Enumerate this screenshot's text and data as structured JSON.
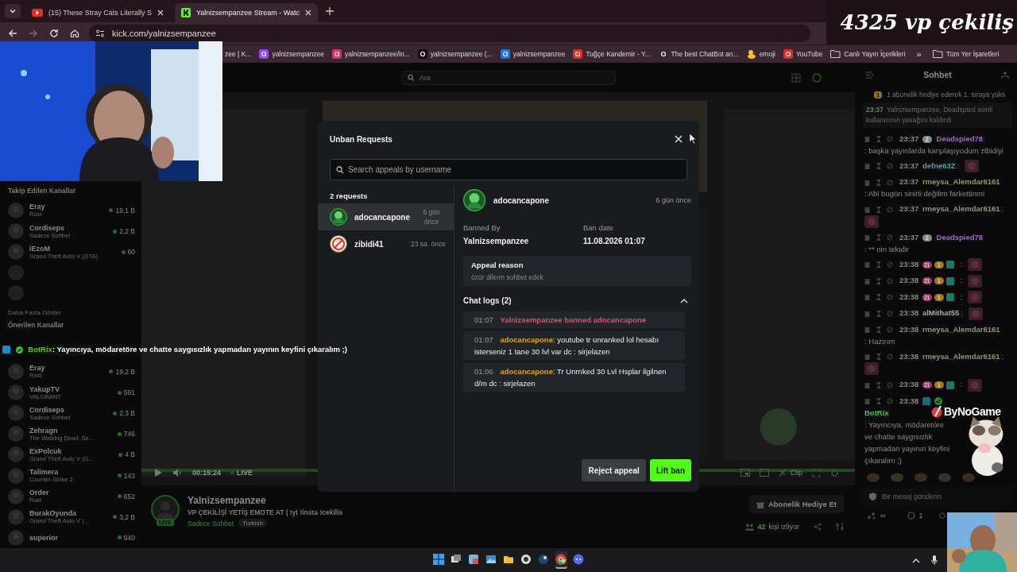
{
  "overlay": {
    "title": "4325 vp çekiliş",
    "sponsor": "ByNoGame",
    "bot_user": "BotRix",
    "bot_text": ": Yayıncıya, mödaretöre ve chatte saygısızlık yapmadan yayının keyfini çıkaralım ;)"
  },
  "browser": {
    "tabs": [
      {
        "title": "(15) These Stray Cats Literally S",
        "kind": "youtube",
        "selected": false
      },
      {
        "title": "Yalnizsempanzee Stream - Watc",
        "kind": "kick",
        "selected": true
      }
    ],
    "url": "kick.com/yalnizsempanzee",
    "bookmarks": [
      {
        "label": "zee | K...",
        "kind": "none"
      },
      {
        "label": "yalnizsempanzee",
        "kind": "twitch"
      },
      {
        "label": "yalnizsempanzee/in...",
        "kind": "instagram"
      },
      {
        "label": "yalnizsempanzee (...",
        "kind": "tiktok"
      },
      {
        "label": "yalnizsempanzee",
        "kind": "facebook"
      },
      {
        "label": "Tuğçe Kandemir - Y...",
        "kind": "youtube"
      },
      {
        "label": "The best ChatBot an...",
        "kind": "chatbot"
      },
      {
        "label": "emoji",
        "kind": "duck"
      },
      {
        "label": "YouTube",
        "kind": "youtube"
      },
      {
        "label": "Canlı Yayın İçerikleri",
        "kind": "folder"
      }
    ],
    "more": "»",
    "all_bookmarks": "Tüm Yer İşaretleri"
  },
  "sidebar": {
    "followed_title": "Takip Edilen Kanallar",
    "followed": [
      {
        "kind": "live",
        "name": "Eray",
        "category": "Rust",
        "viewers": "19,1 B"
      },
      {
        "kind": "live",
        "name": "Cordiseps",
        "category": "Sadece Sohbet",
        "viewers": "2,2 B"
      },
      {
        "kind": "live",
        "name": "iEzoM",
        "category": "Grand Theft Auto V (GTA)",
        "viewers": "60"
      },
      {
        "kind": "offline"
      },
      {
        "kind": "offline"
      }
    ],
    "show_more": "Daha Fazla Göster",
    "recommended_title": "Önerilen Kanallar",
    "recommended": [
      {
        "kind": "live",
        "name": "Eray",
        "category": "Rust",
        "viewers": "19,2 B"
      },
      {
        "kind": "live",
        "name": "YakupTV",
        "category": "VALORANT",
        "viewers": "591"
      },
      {
        "kind": "live",
        "name": "Cordiseps",
        "category": "Sadece Sohbet",
        "viewers": "2,3 B"
      },
      {
        "kind": "live",
        "name": "Zehragn",
        "category": "The Walking Dead: Se...",
        "viewers": "746"
      },
      {
        "kind": "live",
        "name": "ExPolcuk",
        "category": "Grand Theft Auto V (G...",
        "viewers": "4 B"
      },
      {
        "kind": "live",
        "name": "Talimera",
        "category": "Counter-Strike 2",
        "viewers": "143"
      },
      {
        "kind": "live",
        "name": "Order",
        "category": "Rust",
        "viewers": "652"
      },
      {
        "kind": "live",
        "name": "BurakOyunda",
        "category": "Grand Theft Auto V (...",
        "viewers": "3,2 B"
      },
      {
        "kind": "live",
        "name": "superior",
        "viewers": "940"
      }
    ]
  },
  "main": {
    "search_placeholder": "Ara",
    "player": {
      "time": "00:15:24",
      "live": "LIVE",
      "clip": "Clip"
    },
    "stream": {
      "live_badge": "LIVE",
      "name": "Yalnizsempanzee",
      "title": "VP ÇEKİLİŞİ YETİŞ EMOTE AT | !yt !insta !cekilis",
      "category": "Sadece Sohbet",
      "tag": "Turkish",
      "gift_button": "Abonelik Hediye Et",
      "viewers": "42",
      "viewers_label": "kişi izliyor"
    }
  },
  "modal": {
    "title": "Unban Requests",
    "search_placeholder": "Search appeals by username",
    "count": "2 requests",
    "requests": [
      {
        "username": "adocancapone",
        "time": "6 gün önce",
        "kind": "green",
        "selected": true
      },
      {
        "username": "zibidi41",
        "time": "23 sa. önce",
        "kind": "banned",
        "selected": false
      }
    ],
    "detail": {
      "username": "adocancapone",
      "time": "6 gün önce",
      "banned_by_label": "Banned By",
      "banned_by": "Yalnizsempanzee",
      "ban_date_label": "Ban date",
      "ban_date": "11.08.2026 01:07",
      "reason_label": "Appeal reason",
      "reason": "özür dilerm sohbet edek",
      "logs_title": "Chat logs (2)",
      "logs_expanded": true,
      "logs": [
        {
          "kind": "event",
          "time": "01:07",
          "text": "Yalnizsempanzee banned adocancapone"
        },
        {
          "kind": "message",
          "time": "01:07",
          "user": "adocancapone",
          "text": ": youtube tr unranked lol hesabı isterseniz 1 tane 30 lvl var dc : sirjelazen"
        },
        {
          "kind": "message",
          "time": "01:06",
          "user": "adocancapone",
          "text": ": Tr Unrnked 30 Lvl Hsplar ilgilnen d/m dc : sirjelazen"
        }
      ]
    },
    "reject_button": "Reject appeal",
    "lift_button": "Lift ban"
  },
  "chat": {
    "title": "Sohbet",
    "pinned_badge": "1",
    "pinned": "1 abonelik hediye ederek 1. sıraya yüks",
    "system_time": "23:37",
    "system_text": "Yalnizsempanzee, Deadspied isimli kullanıcının yasağını kaldırdı",
    "messages": [
      {
        "time": "23:37",
        "badges": [
          {
            "kind": "text",
            "label": "2",
            "color": "#8a8a8a"
          }
        ],
        "user": "Deadspied78",
        "color": "#6a3f8a",
        "text": ": başka yayınlarda karşılaşıyodum zibidiyi",
        "emote": false
      },
      {
        "time": "23:37",
        "user": "defne63Z",
        "color": "#2a6a6a",
        "text": ":",
        "emote": true
      },
      {
        "time": "23:37",
        "user": "rmeysa_Alemdar6161",
        "color": "#5e5e44",
        "text": ": Abi bugün sinirli değilim farkettinmi",
        "emote": false
      },
      {
        "time": "23:37",
        "user": "rmeysa_Alemdar6161",
        "color": "#5e5e44",
        "text": ":",
        "emote": true
      },
      {
        "time": "23:37",
        "badges": [
          {
            "kind": "text",
            "label": "2",
            "color": "#8a8a8a"
          }
        ],
        "user": "Deadspied78",
        "color": "#6a3f8a",
        "text": ": ** nin tekidir",
        "emote": false
      },
      {
        "time": "23:38",
        "badges": [
          {
            "kind": "text",
            "label": "21",
            "color": "#a03a6a"
          },
          {
            "kind": "text",
            "label": "1",
            "color": "#a07a1a"
          },
          {
            "kind": "square",
            "color": "#1a7a6a"
          }
        ],
        "text": ":",
        "emote": true
      },
      {
        "time": "23:38",
        "badges": [
          {
            "kind": "text",
            "label": "21",
            "color": "#a03a6a"
          },
          {
            "kind": "text",
            "label": "1",
            "color": "#a07a1a"
          },
          {
            "kind": "square",
            "color": "#1a7a6a"
          }
        ],
        "text": ":",
        "emote": true
      },
      {
        "time": "23:38",
        "badges": [
          {
            "kind": "text",
            "label": "21",
            "color": "#a03a6a"
          },
          {
            "kind": "text",
            "label": "1",
            "color": "#a07a1a"
          },
          {
            "kind": "square",
            "color": "#1a7a6a"
          }
        ],
        "text": ":",
        "emote": true
      },
      {
        "time": "23:38",
        "user": "alMithat55",
        "color": "#6a6a6a",
        "text": ":",
        "emote": true
      },
      {
        "time": "23:38",
        "user": "rmeysa_Alemdar6161",
        "color": "#5e5e44",
        "text": ": Hazırım",
        "emote": false
      },
      {
        "time": "23:38",
        "user": "rmeysa_Alemdar6161",
        "color": "#5e5e44",
        "text": ":",
        "emote": true
      },
      {
        "time": "23:38",
        "badges": [
          {
            "kind": "text",
            "label": "21",
            "color": "#a03a6a"
          },
          {
            "kind": "text",
            "label": "1",
            "color": "#a07a1a"
          },
          {
            "kind": "square",
            "color": "#1a7a6a"
          }
        ],
        "text": ":",
        "emote": true
      },
      {
        "time": "23:38",
        "badges": [
          {
            "kind": "square",
            "color": "#1a6a7a"
          },
          {
            "kind": "check",
            "color": "#2a8a2a"
          }
        ],
        "user": "BotRix",
        "color": "#2f7a2f",
        "text": ": Yayıncıya, mödaretöre ve chatte saygısızlık yapmadan yayının keyfini çıkaralım ;)",
        "emote": false
      }
    ],
    "input_placeholder": "Bir mesaj gönderin",
    "infinity": "∞",
    "points": "1"
  },
  "taskbar": {
    "apps": [
      {
        "kind": "start",
        "selected": false
      },
      {
        "kind": "taskview",
        "selected": false
      },
      {
        "kind": "widgets",
        "selected": false
      },
      {
        "kind": "photos",
        "selected": false
      },
      {
        "kind": "files",
        "selected": false
      },
      {
        "kind": "obs",
        "selected": false
      },
      {
        "kind": "steam",
        "selected": false
      },
      {
        "kind": "chrome",
        "selected": true
      },
      {
        "kind": "discord",
        "selected": false
      }
    ]
  }
}
